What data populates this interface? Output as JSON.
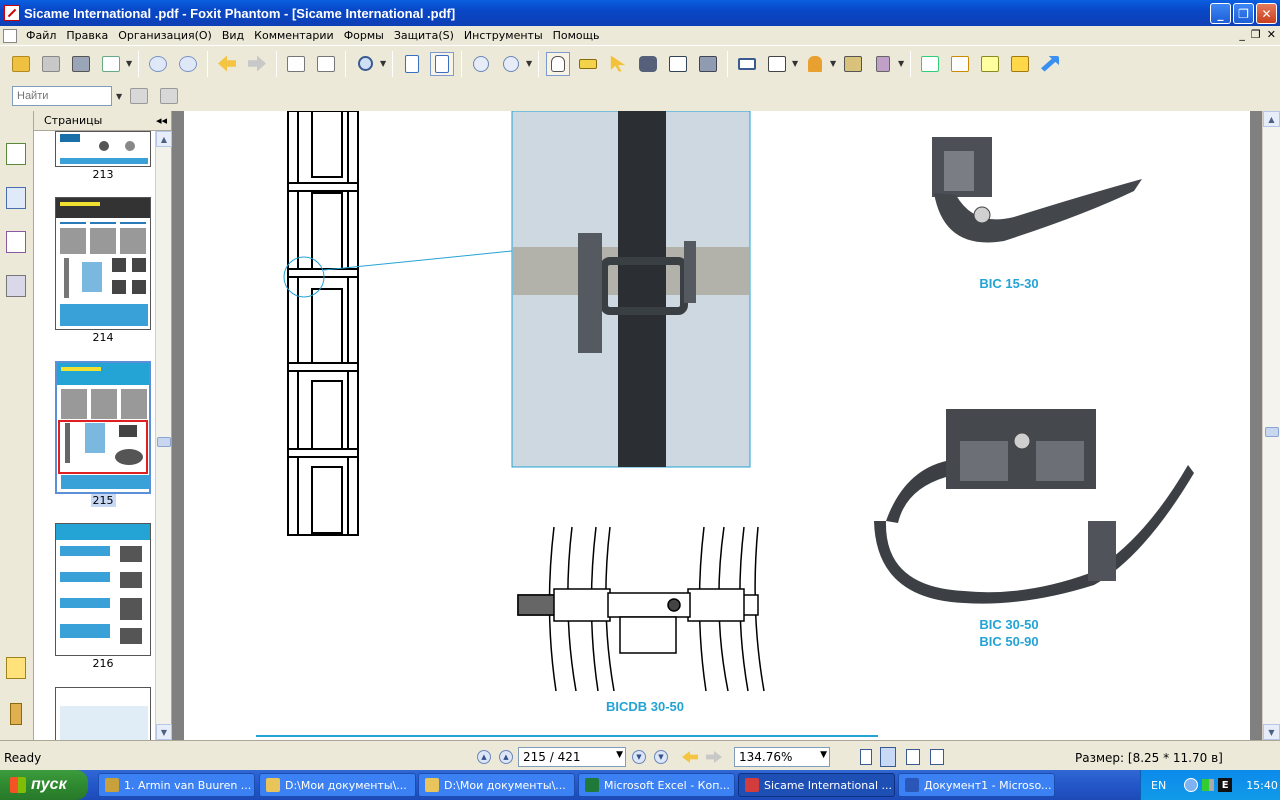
{
  "window": {
    "title": "Sicame International .pdf - Foxit Phantom - [Sicame International .pdf]",
    "buttons": [
      "_",
      "❐",
      "✕"
    ]
  },
  "menu": {
    "items": [
      "Файл",
      "Правка",
      "Организация(O)",
      "Вид",
      "Комментарии",
      "Формы",
      "Защита(S)",
      "Инструменты",
      "Помощь"
    ],
    "mdi_buttons": [
      "_",
      "❐",
      "✕"
    ]
  },
  "toolbar2": {
    "search_placeholder": "Найти"
  },
  "pages_panel": {
    "title": "Страницы",
    "thumbnails": [
      {
        "label": "213",
        "selected": false
      },
      {
        "label": "214",
        "selected": false
      },
      {
        "label": "215",
        "selected": true
      },
      {
        "label": "216",
        "selected": false
      }
    ]
  },
  "document": {
    "captions": {
      "bic_15_30": "BIC 15-30",
      "bic_30_50": "BIC 30-50",
      "bic_50_90": "BIC 50-90",
      "bicdb_30_50": "BICDB 30-50"
    }
  },
  "statusbar": {
    "ready": "Ready",
    "page_field": "215 / 421",
    "zoom_field": "134.76%",
    "size_text": "Размер: [8.25 * 11.70 в]"
  },
  "taskbar": {
    "start_label": "пуск",
    "tasks": [
      {
        "label": "1. Armin van Buuren ...",
        "color": "#c8a03c",
        "active": false
      },
      {
        "label": "D:\\Мои документы\\...",
        "color": "#e8c45a",
        "active": false
      },
      {
        "label": "D:\\Мои документы\\...",
        "color": "#e8c45a",
        "active": false
      },
      {
        "label": "Microsoft Excel - Коп...",
        "color": "#1f7a3a",
        "active": false
      },
      {
        "label": "Sicame International ...",
        "color": "#d23c3c",
        "active": true
      },
      {
        "label": "Документ1 - Microso...",
        "color": "#2a56b8",
        "active": false
      }
    ],
    "tray": {
      "lang": "EN",
      "time": "15:40"
    }
  }
}
